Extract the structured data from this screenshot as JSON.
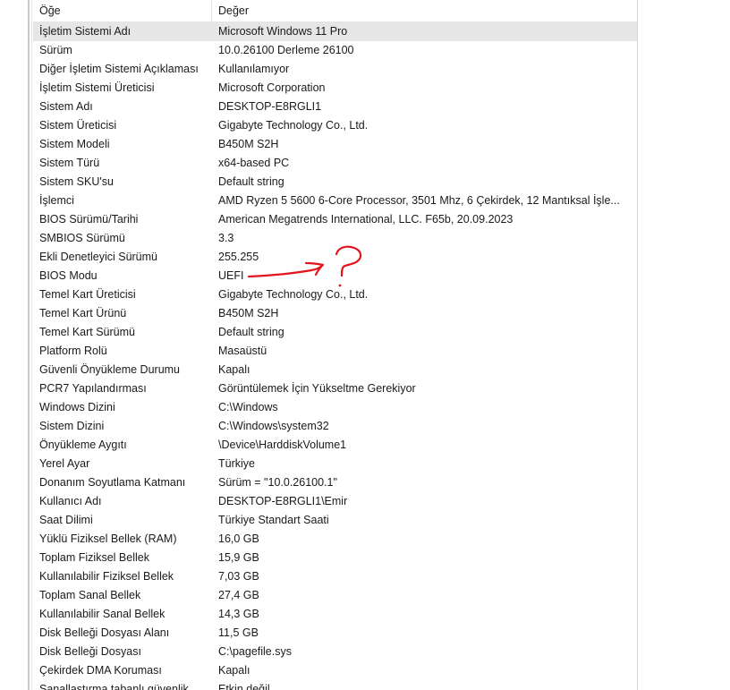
{
  "header": {
    "item_label": "Öğe",
    "value_label": "Değer"
  },
  "rows": [
    {
      "k": "İşletim Sistemi Adı",
      "v": "Microsoft Windows 11 Pro"
    },
    {
      "k": "Sürüm",
      "v": "10.0.26100 Derleme 26100"
    },
    {
      "k": "Diğer İşletim Sistemi Açıklaması",
      "v": "Kullanılamıyor"
    },
    {
      "k": "İşletim Sistemi Üreticisi",
      "v": "Microsoft Corporation"
    },
    {
      "k": "Sistem Adı",
      "v": "DESKTOP-E8RGLI1"
    },
    {
      "k": "Sistem Üreticisi",
      "v": "Gigabyte Technology Co., Ltd."
    },
    {
      "k": "Sistem Modeli",
      "v": "B450M S2H"
    },
    {
      "k": "Sistem Türü",
      "v": "x64-based PC"
    },
    {
      "k": "Sistem SKU'su",
      "v": "Default string"
    },
    {
      "k": "İşlemci",
      "v": "AMD Ryzen 5 5600 6-Core Processor, 3501 Mhz, 6 Çekirdek, 12 Mantıksal İşle..."
    },
    {
      "k": "BIOS Sürümü/Tarihi",
      "v": "American Megatrends International, LLC. F65b, 20.09.2023"
    },
    {
      "k": "SMBIOS Sürümü",
      "v": "3.3"
    },
    {
      "k": "Ekli Denetleyici Sürümü",
      "v": "255.255"
    },
    {
      "k": "BIOS Modu",
      "v": "UEFI"
    },
    {
      "k": "Temel Kart Üreticisi",
      "v": "Gigabyte Technology Co., Ltd."
    },
    {
      "k": "Temel Kart Ürünü",
      "v": "B450M S2H"
    },
    {
      "k": "Temel Kart Sürümü",
      "v": "Default string"
    },
    {
      "k": "Platform Rolü",
      "v": "Masaüstü"
    },
    {
      "k": "Güvenli Önyükleme Durumu",
      "v": "Kapalı"
    },
    {
      "k": "PCR7 Yapılandırması",
      "v": "Görüntülemek İçin Yükseltme Gerekiyor"
    },
    {
      "k": "Windows Dizini",
      "v": "C:\\Windows"
    },
    {
      "k": "Sistem Dizini",
      "v": "C:\\Windows\\system32"
    },
    {
      "k": "Önyükleme Aygıtı",
      "v": "\\Device\\HarddiskVolume1"
    },
    {
      "k": "Yerel Ayar",
      "v": "Türkiye"
    },
    {
      "k": "Donanım Soyutlama Katmanı",
      "v": "Sürüm = \"10.0.26100.1\""
    },
    {
      "k": "Kullanıcı Adı",
      "v": "DESKTOP-E8RGLI1\\Emir"
    },
    {
      "k": "Saat Dilimi",
      "v": "Türkiye Standart Saati"
    },
    {
      "k": "Yüklü Fiziksel Bellek (RAM)",
      "v": "16,0 GB"
    },
    {
      "k": "Toplam Fiziksel Bellek",
      "v": "15,9 GB"
    },
    {
      "k": "Kullanılabilir Fiziksel Bellek",
      "v": "7,03 GB"
    },
    {
      "k": "Toplam Sanal Bellek",
      "v": "27,4 GB"
    },
    {
      "k": "Kullanılabilir Sanal Bellek",
      "v": "14,3 GB"
    },
    {
      "k": "Disk Belleği Dosyası Alanı",
      "v": "11,5 GB"
    },
    {
      "k": "Disk Belleği Dosyası",
      "v": "C:\\pagefile.sys"
    },
    {
      "k": "Çekirdek DMA Koruması",
      "v": "Kapalı"
    },
    {
      "k": "Sanallaştırma tabanlı güvenlik",
      "v": "Etkin değil"
    }
  ],
  "selected_row": 0,
  "colors": {
    "selection": "#e6e6e6",
    "annotation": "#e4141c"
  },
  "annotation": {
    "icon": "hand-drawn-arrow-question-mark"
  }
}
